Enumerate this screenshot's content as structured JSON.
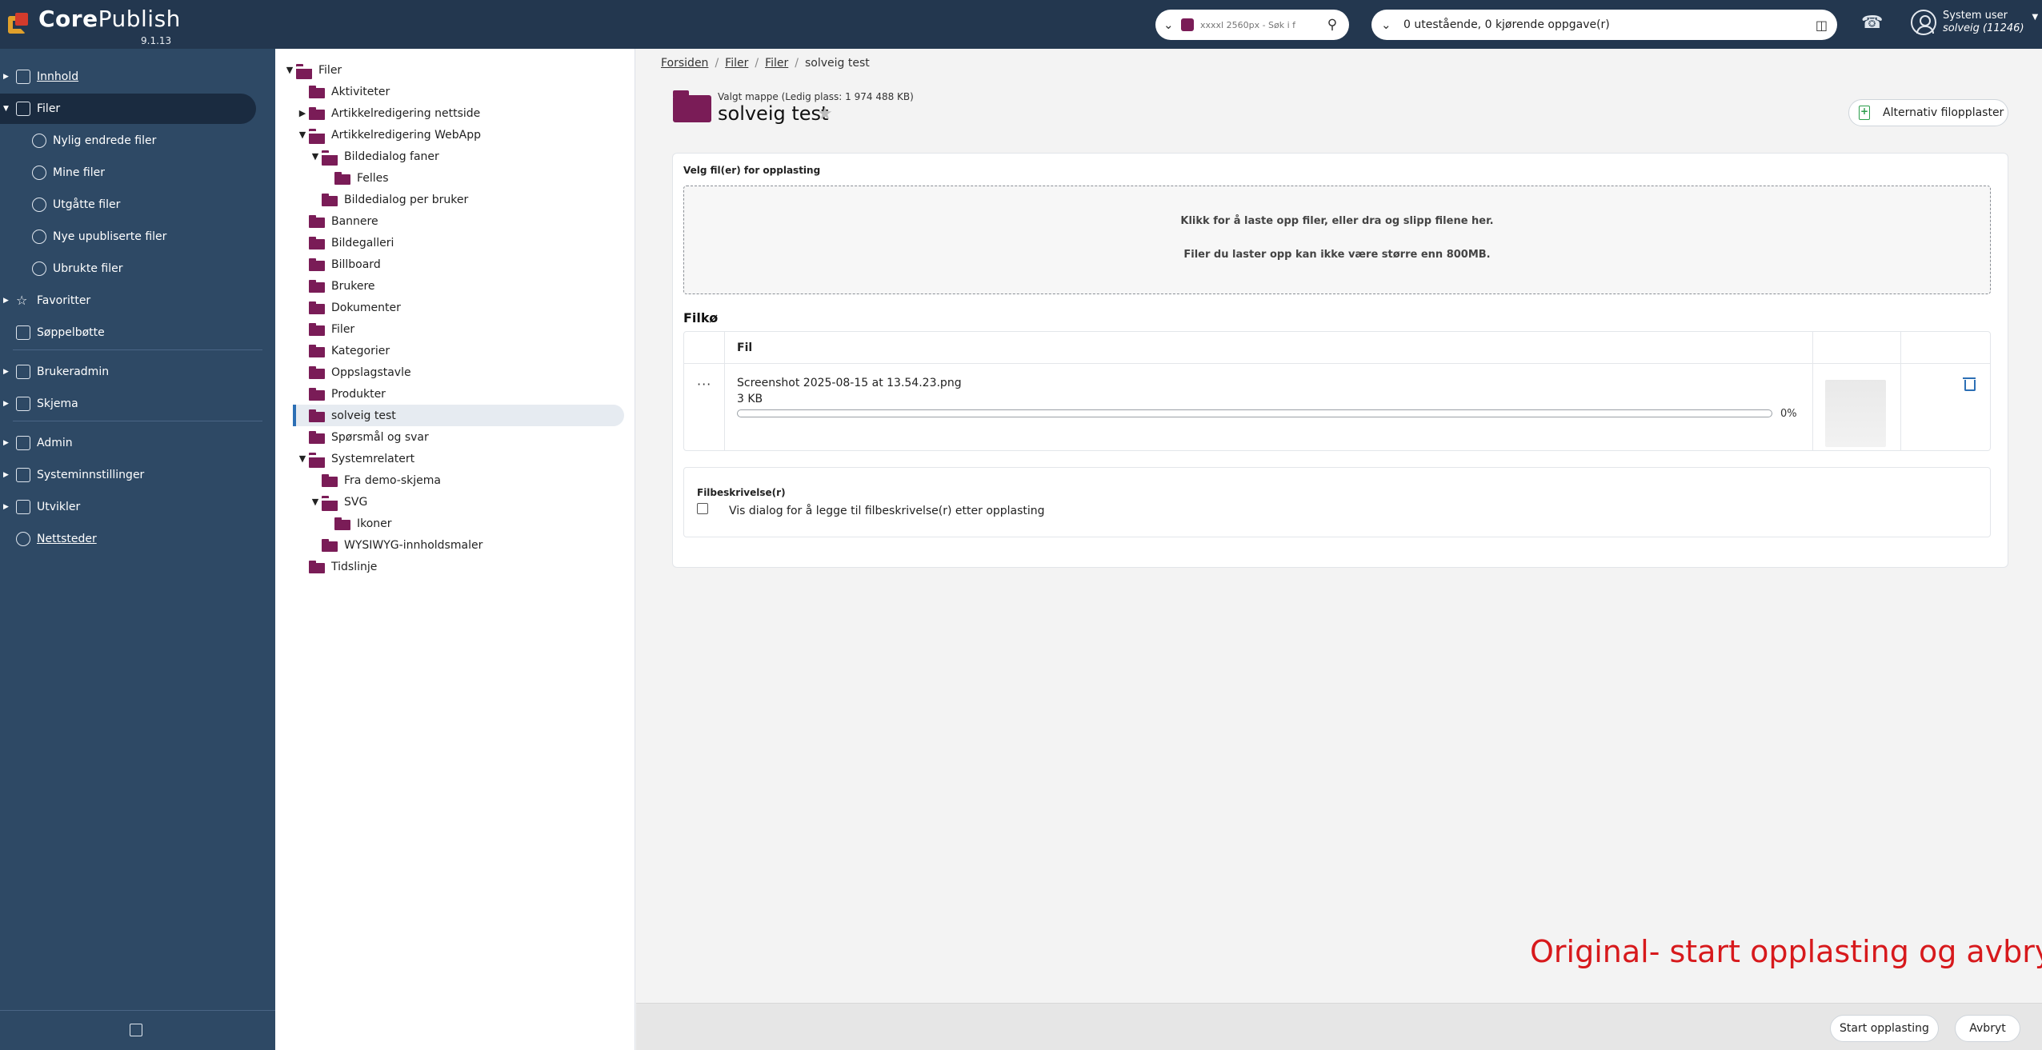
{
  "app": {
    "name_bold": "Core",
    "name_light": "Publish",
    "version": "9.1.13"
  },
  "search": {
    "placeholder": "xxxxl 2560px - Søk i f"
  },
  "tasks": {
    "label": "0 utestående, 0 kjørende oppgave(r)"
  },
  "user": {
    "name": "System user",
    "sub": "solveig (11246)"
  },
  "sidebar": {
    "items": [
      {
        "label": "Innhold",
        "icon": "document-icon"
      },
      {
        "label": "Filer",
        "icon": "images-icon"
      },
      {
        "label": "Nylig endrede filer",
        "icon": "clock-icon"
      },
      {
        "label": "Mine filer",
        "icon": "user-file-icon"
      },
      {
        "label": "Utgåtte filer",
        "icon": "expired-icon"
      },
      {
        "label": "Nye upubliserte filer",
        "icon": "new-file-icon"
      },
      {
        "label": "Ubrukte filer",
        "icon": "unused-icon"
      },
      {
        "label": "Favoritter",
        "icon": "star-icon"
      },
      {
        "label": "Søppelbøtte",
        "icon": "trash-icon"
      },
      {
        "label": "Brukeradmin",
        "icon": "users-icon"
      },
      {
        "label": "Skjema",
        "icon": "form-icon"
      },
      {
        "label": "Admin",
        "icon": "admin-icon"
      },
      {
        "label": "Systeminnstillinger",
        "icon": "gears-icon"
      },
      {
        "label": "Utvikler",
        "icon": "code-icon"
      },
      {
        "label": "Nettsteder",
        "icon": "globe-icon"
      }
    ]
  },
  "tree": {
    "items": [
      "Filer",
      "Aktiviteter",
      "Artikkelredigering nettside",
      "Artikkelredigering WebApp",
      "Bildedialog faner",
      "Felles",
      "Bildedialog per bruker",
      "Bannere",
      "Bildegalleri",
      "Billboard",
      "Brukere",
      "Dokumenter",
      "Filer",
      "Kategorier",
      "Oppslagstavle",
      "Produkter",
      "solveig test",
      "Spørsmål og svar",
      "Systemrelatert",
      "Fra demo-skjema",
      "SVG",
      "Ikoner",
      "WYSIWYG-innholdsmaler",
      "Tidslinje"
    ]
  },
  "breadcrumb": {
    "home": "Forsiden",
    "c1": "Filer",
    "c2": "Filer",
    "current": "solveig test",
    "sep": "/"
  },
  "folder": {
    "subtitle": "Valgt mappe (Ledig plass: 1 974 488 KB)",
    "title": "solveig test"
  },
  "alt_upload": {
    "label": "Alternativ filopplaster"
  },
  "upload": {
    "label": "Velg fil(er) for opplasting",
    "drop_line1": "Klikk for å laste opp filer, eller dra og slipp filene her.",
    "drop_line2": "Filer du laster opp kan ikke være større enn 800MB."
  },
  "queue": {
    "title": "Filkø",
    "col_file": "Fil",
    "file_name": "Screenshot 2025-08-15 at 13.54.23.png",
    "file_size": "3 KB",
    "progress_text": "0%",
    "progress": 0
  },
  "description": {
    "label": "Filbeskrivelse(r)",
    "checkbox_label": "Vis dialog for å legge til filbeskrivelse(r) etter opplasting"
  },
  "annotation": "Original-  start opplasting og avbryt",
  "footer": {
    "start": "Start opplasting",
    "cancel": "Avbryt"
  },
  "colors": {
    "topbar": "#23374f",
    "sidebar": "#2e4965",
    "folder": "#7a1c57",
    "annotation": "#d7191c"
  }
}
